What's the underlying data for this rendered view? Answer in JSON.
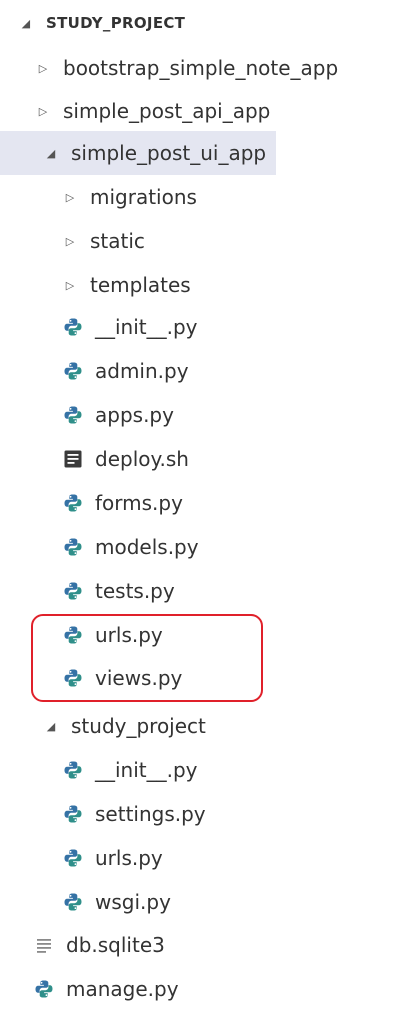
{
  "explorer": {
    "root": "STUDY_PROJECT",
    "items": [
      {
        "label": "bootstrap_simple_note_app",
        "type": "folder",
        "expanded": false
      },
      {
        "label": "simple_post_api_app",
        "type": "folder",
        "expanded": false
      },
      {
        "label": "simple_post_ui_app",
        "type": "folder",
        "expanded": true,
        "selected": true
      },
      {
        "label": "migrations",
        "type": "folder",
        "expanded": false
      },
      {
        "label": "static",
        "type": "folder",
        "expanded": false
      },
      {
        "label": "templates",
        "type": "folder",
        "expanded": false
      },
      {
        "label": "__init__.py",
        "type": "python"
      },
      {
        "label": "admin.py",
        "type": "python"
      },
      {
        "label": "apps.py",
        "type": "python"
      },
      {
        "label": "deploy.sh",
        "type": "shell"
      },
      {
        "label": "forms.py",
        "type": "python"
      },
      {
        "label": "models.py",
        "type": "python"
      },
      {
        "label": "tests.py",
        "type": "python"
      },
      {
        "label": "urls.py",
        "type": "python"
      },
      {
        "label": "views.py",
        "type": "python"
      },
      {
        "label": "study_project",
        "type": "folder",
        "expanded": true
      },
      {
        "label": "__init__.py",
        "type": "python"
      },
      {
        "label": "settings.py",
        "type": "python"
      },
      {
        "label": "urls.py",
        "type": "python"
      },
      {
        "label": "wsgi.py",
        "type": "python"
      },
      {
        "label": "db.sqlite3",
        "type": "database"
      },
      {
        "label": "manage.py",
        "type": "python"
      }
    ]
  },
  "colors": {
    "selected_bg": "#e4e6f1",
    "highlight_border": "#e0202a",
    "python_blue": "#3572a5",
    "python_teal": "#2f8f8a"
  }
}
